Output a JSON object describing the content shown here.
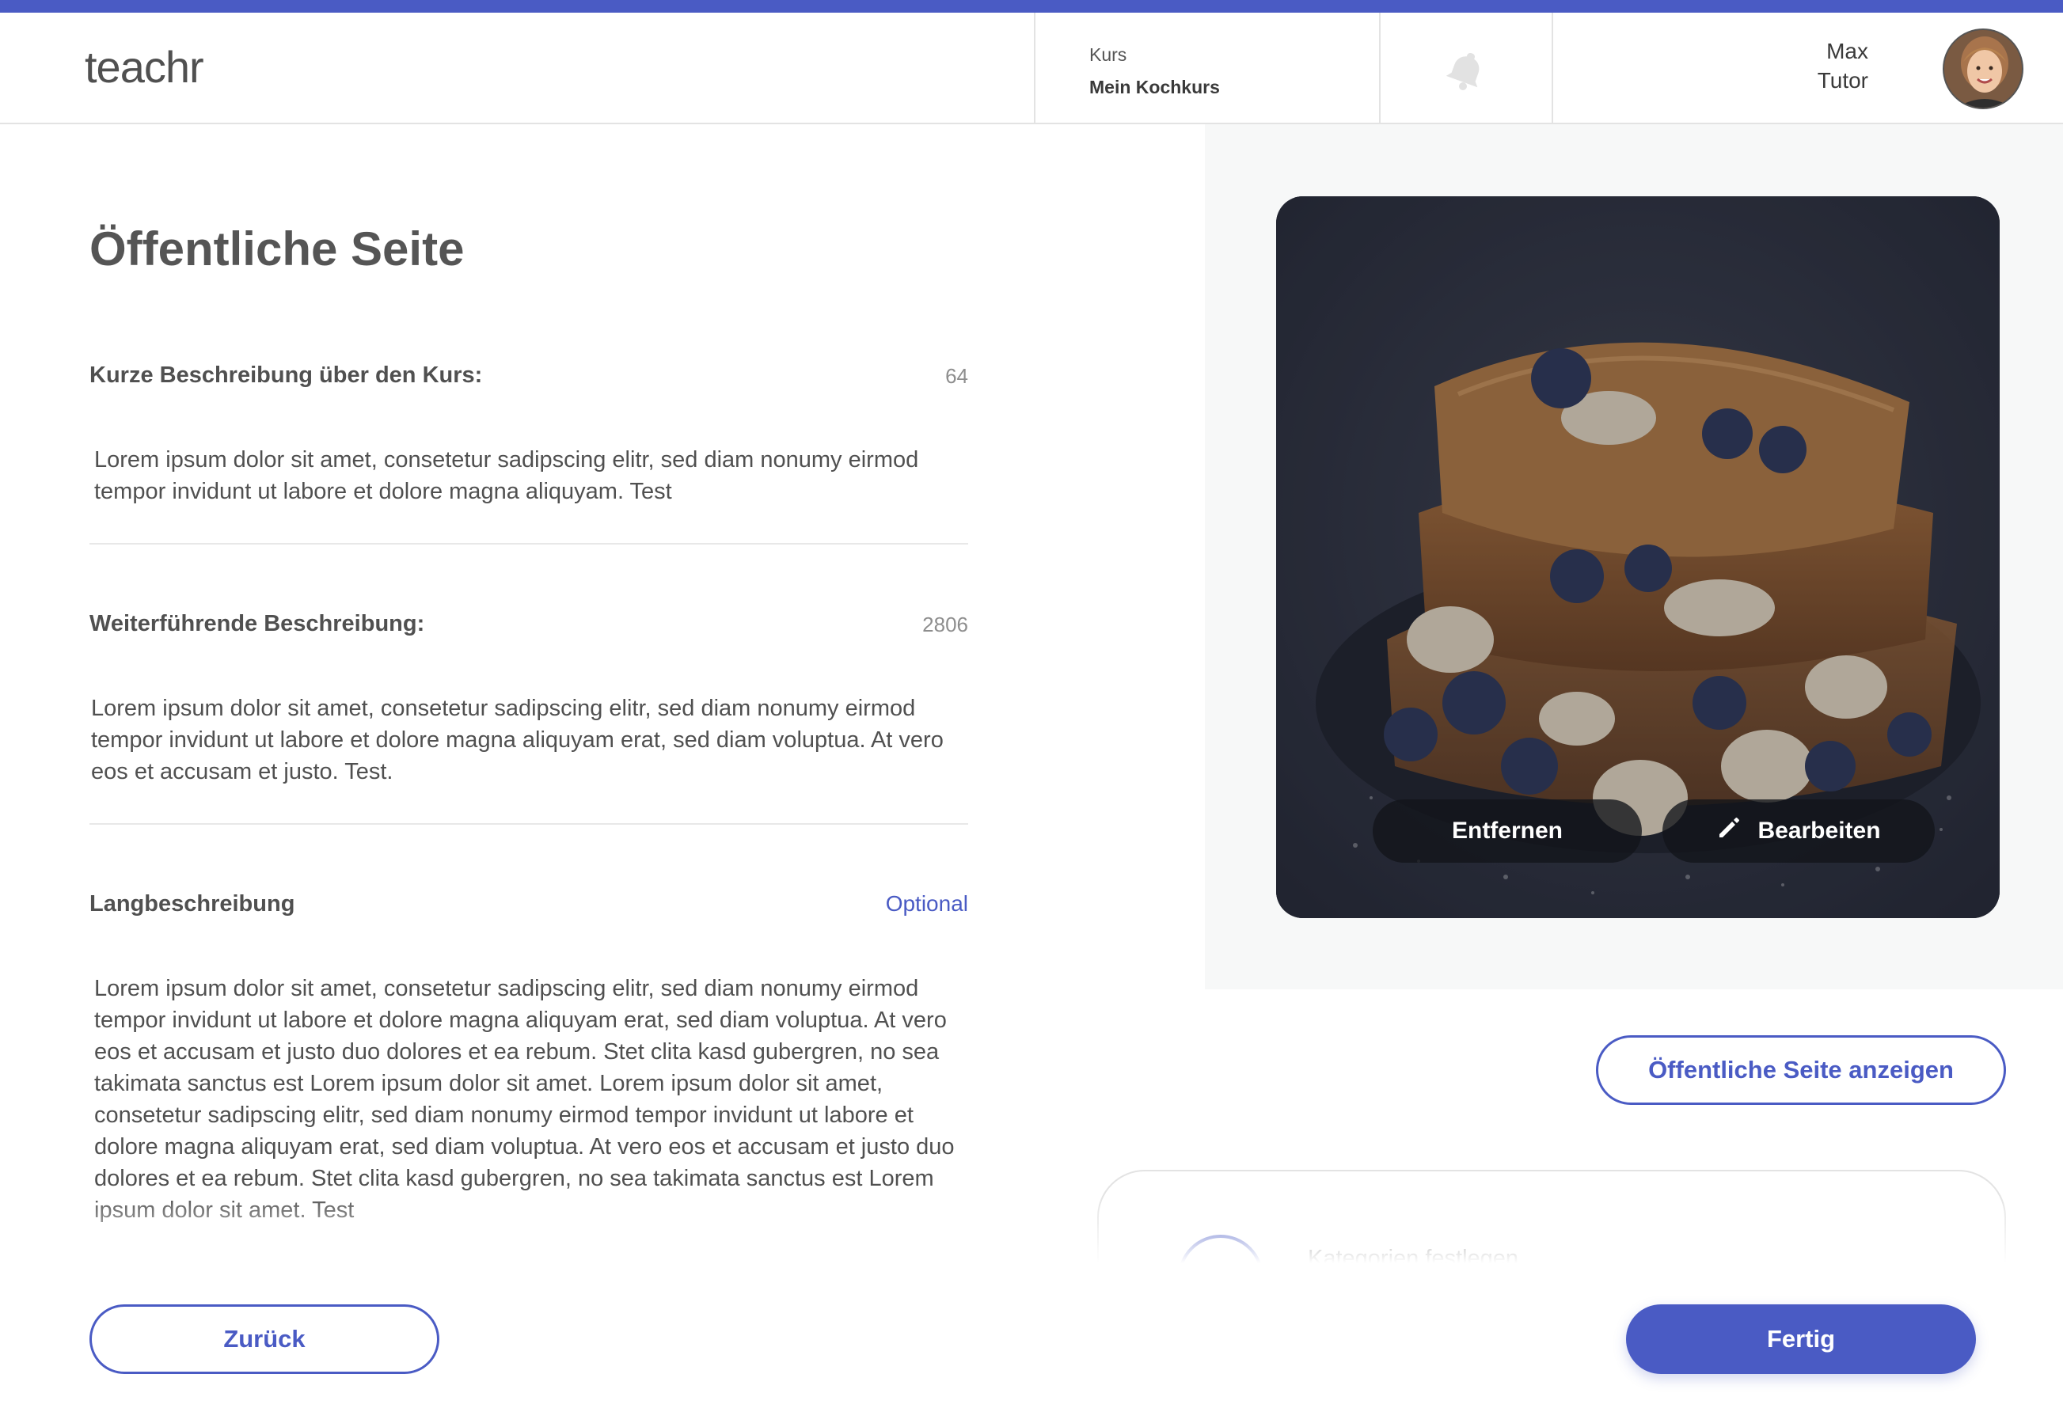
{
  "header": {
    "logo": "teachr",
    "course_label": "Kurs",
    "course_name": "Mein Kochkurs",
    "user_first_name": "Max",
    "user_last_name": "Tutor",
    "accent_color": "#4a5bc4"
  },
  "page": {
    "title": "Öffentliche Seite"
  },
  "fields": {
    "short": {
      "label": "Kurze Beschreibung über den Kurs:",
      "count": "64",
      "text": "Lorem ipsum dolor sit amet, consetetur sadipscing elitr, sed diam nonumy eirmod tempor invidunt ut labore et dolore magna aliquyam. Test"
    },
    "further": {
      "label": "Weiterführende Beschreibung:",
      "count": "2806",
      "text": "Lorem ipsum dolor sit amet, consetetur sadipscing elitr, sed diam nonumy eirmod tempor invidunt ut labore et dolore magna aliquyam erat, sed diam voluptua. At vero eos et accusam et justo. Test."
    },
    "long": {
      "label": "Langbeschreibung",
      "optional": "Optional",
      "text": "Lorem ipsum dolor sit amet, consetetur sadipscing elitr, sed diam nonumy eirmod tempor invidunt ut labore et dolore magna aliquyam erat, sed diam voluptua. At vero eos et accusam et justo duo dolores et ea rebum. Stet clita kasd gubergren, no sea takimata sanctus est Lorem ipsum dolor sit amet. Lorem ipsum dolor sit amet, consetetur sadipscing elitr, sed diam nonumy eirmod tempor invidunt ut labore et dolore magna aliquyam erat, sed diam voluptua. At vero eos et accusam et justo duo dolores et ea rebum. Stet clita kasd gubergren, no sea takimata sanctus est Lorem ipsum dolor sit amet. Test"
    }
  },
  "image": {
    "remove_label": "Entfernen",
    "edit_label": "Bearbeiten",
    "edit_icon": "pencil-icon"
  },
  "actions": {
    "view_public_page": "Öffentliche Seite anzeigen",
    "categories_label": "Kategorien festlegen",
    "back": "Zurück",
    "done": "Fertig"
  }
}
